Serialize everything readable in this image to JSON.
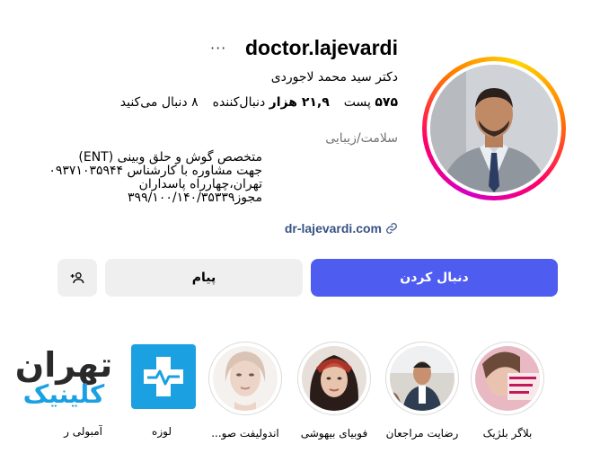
{
  "profile": {
    "username": "doctor.lajevardi",
    "more": "···",
    "full_name": "دکتر سید محمد لاجوردی",
    "stats": {
      "posts_count": "۵۷۵",
      "posts_label": "پست",
      "followers_count": "۲۱,۹ هزار",
      "followers_label": "دنبال‌کننده",
      "following_count": "۸",
      "following_label": "دنبال می‌کنید"
    },
    "category": "سلامت/زیبایی",
    "bio": [
      "متخصص گوش و حلق وبینی (ENT)",
      "جهت مشاوره با کارشناس ۰۹۳۷۱۰۳۵۹۴۴",
      "تهران،چهارراه پاسداران",
      "مجوز۳۹۹/۱۰۰/۱۴۰/۳۵۳۳۹"
    ],
    "link": "dr-lajevardi.com"
  },
  "buttons": {
    "follow": "دنبال کردن",
    "message": "پیام",
    "suggest_icon": "add-person-icon"
  },
  "highlights": [
    {
      "label": "بلاگر بلژیک"
    },
    {
      "label": "رضایت مراجعان"
    },
    {
      "label": "فوبیای بیهوشی"
    },
    {
      "label": "اندولیفت صو..."
    },
    {
      "label": "لوزه"
    },
    {
      "label": "آمبولی ر"
    }
  ],
  "watermark": {
    "line1": "تهران",
    "line2": "کلینیک"
  },
  "colors": {
    "follow_button": "#4f5cf0",
    "secondary_button": "#efefef",
    "link": "#385185",
    "clinic_blue": "#1ba1e2"
  }
}
